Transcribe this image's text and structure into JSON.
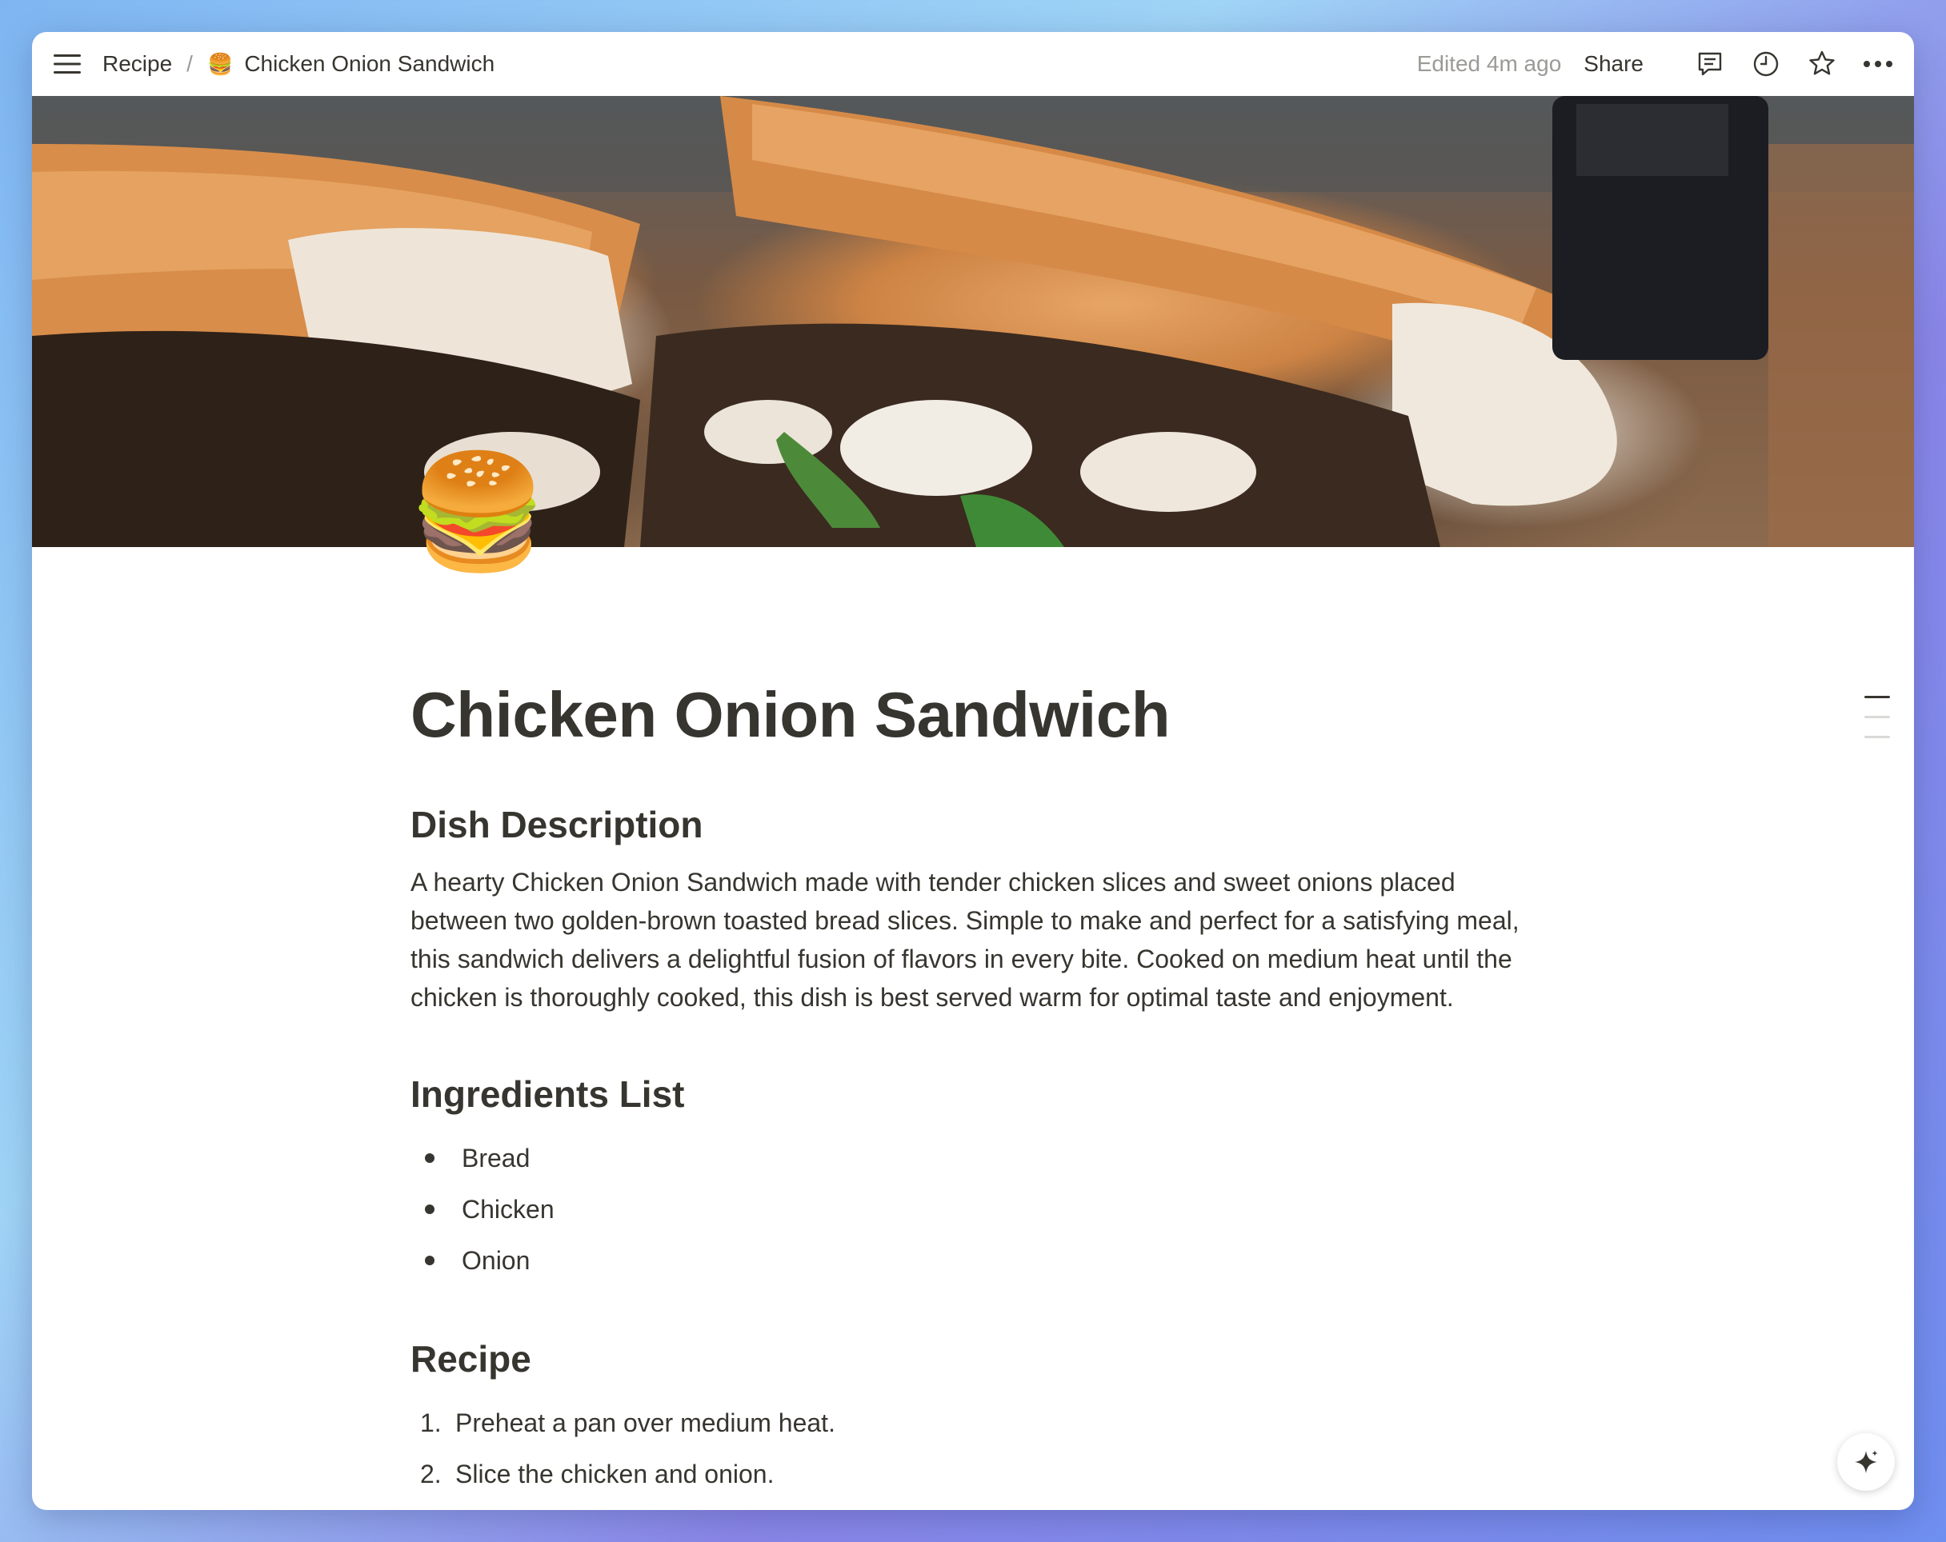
{
  "topbar": {
    "breadcrumb_root": "Recipe",
    "breadcrumb_separator": "/",
    "breadcrumb_page_emoji": "🍔",
    "breadcrumb_page": "Chicken Onion Sandwich",
    "edited": "Edited 4m ago",
    "share_label": "Share",
    "icons": [
      "menu-icon",
      "comment-icon",
      "clock-icon",
      "star-icon",
      "more-icon"
    ]
  },
  "page": {
    "emoji": "🍔",
    "title": "Chicken Onion Sandwich",
    "sections": {
      "description": {
        "heading": "Dish Description",
        "text": "A hearty Chicken Onion Sandwich made with tender chicken slices and sweet onions placed between two golden-brown toasted bread slices. Simple to make and perfect for a satisfying meal, this sandwich delivers a delightful fusion of flavors in every bite. Cooked on medium heat until the chicken is thoroughly cooked, this dish is best served warm for optimal taste and enjoyment."
      },
      "ingredients": {
        "heading": "Ingredients List",
        "items": [
          "Bread",
          "Chicken",
          "Onion"
        ]
      },
      "recipe": {
        "heading": "Recipe",
        "steps": [
          {
            "num": "1.",
            "text": "Preheat a pan over medium heat."
          },
          {
            "num": "2.",
            "text": "Slice the chicken and onion."
          }
        ]
      }
    }
  },
  "colors": {
    "text": "#37352f",
    "muted": "#9b9a97",
    "toc_active": "#37352f",
    "toc_inactive": "#d9d9d7"
  }
}
